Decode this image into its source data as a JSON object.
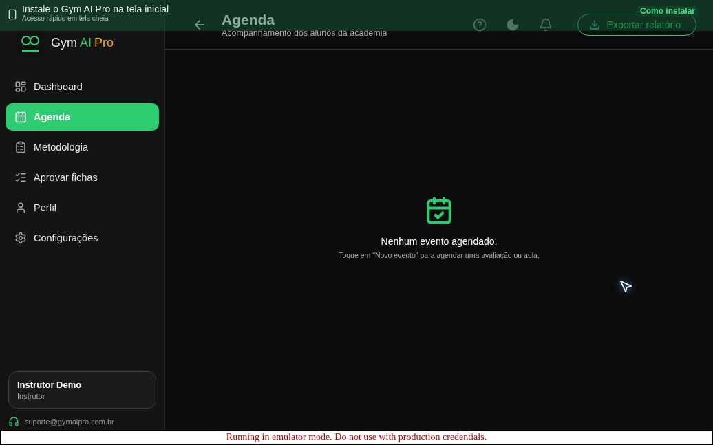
{
  "install_banner": {
    "title": "Instale o Gym AI Pro na tela inicial",
    "subtitle": "Acesso rápido em tela cheia",
    "action": "Como instalar"
  },
  "brand": {
    "parts": [
      {
        "text": "Gym",
        "color": "#e8e8e8"
      },
      {
        "text": "AI",
        "color": "#2ecc71"
      },
      {
        "text": "Pro",
        "color": "#f5a623"
      }
    ]
  },
  "sidebar": {
    "items": [
      {
        "label": "Dashboard",
        "selected": false
      },
      {
        "label": "Agenda",
        "selected": true
      },
      {
        "label": "Metodologia",
        "selected": false
      },
      {
        "label": "Aprovar fichas",
        "selected": false
      },
      {
        "label": "Perfil",
        "selected": false
      },
      {
        "label": "Configurações",
        "selected": false
      }
    ],
    "user": {
      "name": "Instrutor Demo",
      "role": "Instrutor"
    },
    "support_email": "suporte@gymaipro.com.br"
  },
  "header": {
    "title": "Agenda",
    "subtitle": "Acompanhamento dos alunos da academia",
    "export_button": "Exportar relatório"
  },
  "empty_state": {
    "title": "Nenhum evento agendado.",
    "message": "Toque em \"Novo evento\" para agendar uma avaliação ou aula."
  },
  "emulator_notice": "Running in emulator mode. Do not use with production credentials."
}
